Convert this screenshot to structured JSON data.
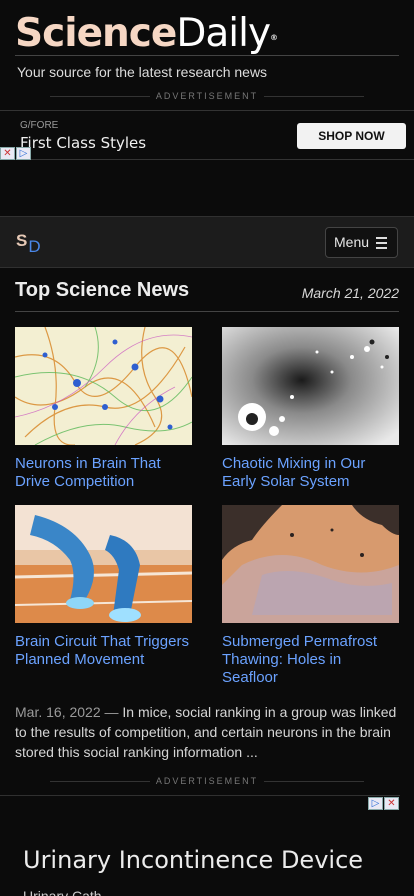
{
  "brand": {
    "logo_part1": "Science",
    "logo_part2": "Daily",
    "logo_reg": "®",
    "tagline": "Your source for the latest research news"
  },
  "ads": {
    "label": "ADVERTISEMENT",
    "top": {
      "brand": "G/FORE",
      "title": "First Class Styles",
      "cta": "SHOP NOW"
    },
    "bottom": {
      "title": "Urinary Incontinence Device",
      "subtitle": "Urinary Cath..."
    }
  },
  "nav": {
    "logo_s": "S",
    "logo_d": "D",
    "menu_label": "Menu"
  },
  "section": {
    "title": "Top Science News",
    "date": "March 21, 2022"
  },
  "cards": [
    {
      "title": "Neurons in Brain That Drive Competition",
      "image": "neurons-illustration"
    },
    {
      "title": "Chaotic Mixing in Our Early Solar System",
      "image": "solar-system-dust"
    },
    {
      "title": "Brain Circuit That Triggers Planned Movement",
      "image": "runner-starting-block"
    },
    {
      "title": "Submerged Permafrost Thawing: Holes in Seafloor",
      "image": "seafloor-map"
    }
  ],
  "summary": {
    "date": "Mar. 16, 2022",
    "separator": "—",
    "text": "In mice, social ranking in a group was linked to the results of competition, and certain neurons in the brain stored this social ranking information ..."
  },
  "colors": {
    "background": "#0b0b0b",
    "link": "#6ba2ff",
    "logo_accent": "#f6d7c4",
    "navbar": "#1c1c1c"
  }
}
